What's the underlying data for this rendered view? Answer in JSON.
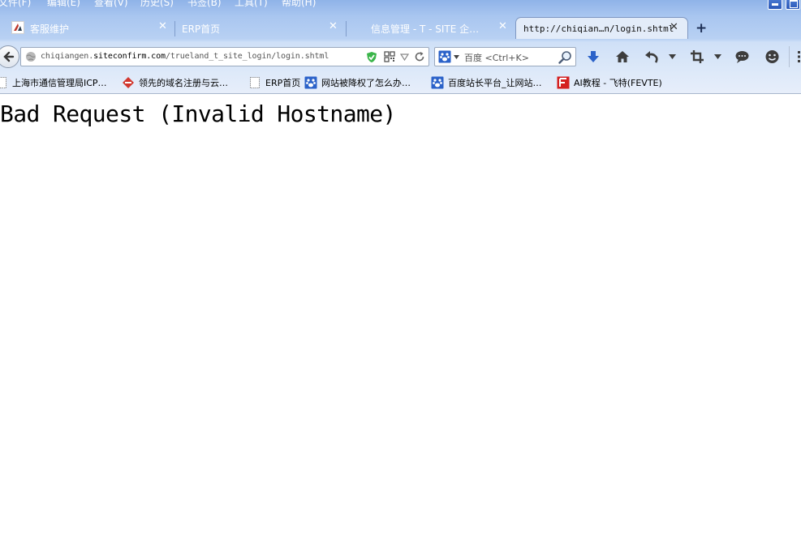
{
  "menu": {
    "items": [
      "文件(F)",
      "编辑(E)",
      "查看(V)",
      "历史(S)",
      "书签(B)",
      "工具(T)",
      "帮助(H)"
    ]
  },
  "tabs": [
    {
      "label": "客服维护",
      "icon": "site-favicon-icon",
      "active": false
    },
    {
      "label": "ERP首页",
      "icon": "none",
      "active": false
    },
    {
      "label": "信息管理 - T - SITE 企…",
      "icon": "none",
      "active": false
    },
    {
      "label": "http://chiqian…n/login.shtml",
      "icon": "none",
      "active": true
    }
  ],
  "tab_close_glyph": "✕",
  "new_tab_glyph": "+",
  "address": {
    "url_prefix": "chiqiangen.",
    "url_domain": "siteconfirm.com",
    "url_path": "/trueland_t_site_login/login.shtml"
  },
  "search": {
    "placeholder": "百度 <Ctrl+K>"
  },
  "bookmarks": [
    {
      "label": "上海市通信管理局ICP…",
      "icon": "blank-page-icon"
    },
    {
      "label": "领先的域名注册与云…",
      "icon": "diamond-logo-icon"
    },
    {
      "label": "ERP首页",
      "icon": "blank-page-icon"
    },
    {
      "label": "网站被降权了怎么办…",
      "icon": "baidu-paw-icon"
    },
    {
      "label": "百度站长平台_让网站…",
      "icon": "baidu-paw-icon"
    },
    {
      "label": "AI教程 - 飞特(FEVTE)",
      "icon": "fevte-logo-icon"
    }
  ],
  "page": {
    "heading": "Bad Request (Invalid Hostname)"
  },
  "colors": {
    "accent_blue": "#2b62c9",
    "page_background": "#ffffff",
    "heading_text": "#000000"
  }
}
